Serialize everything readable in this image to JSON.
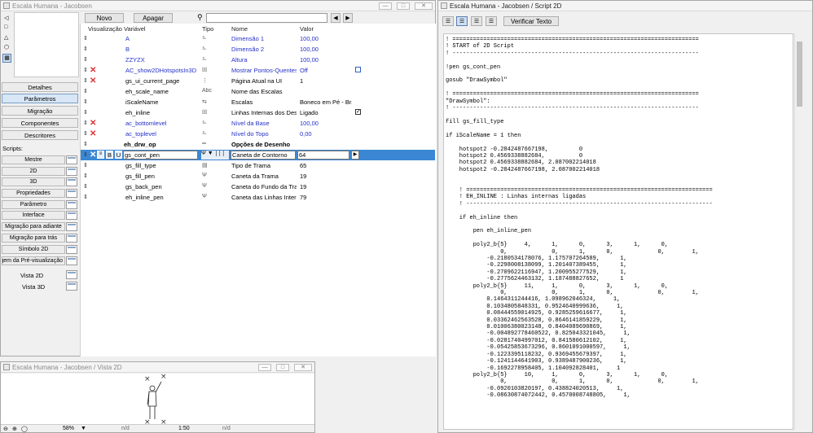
{
  "param_window": {
    "title": "Escala Humana - Jacobsen",
    "new_button": "Novo",
    "delete_button": "Apagar",
    "search_value": "",
    "nav": [
      "Detalhes",
      "Parâmetros",
      "Migração",
      "Componentes",
      "Descritores"
    ],
    "scripts_label": "Scripts:",
    "scripts": [
      "Mestre",
      "2D",
      "3D",
      "Propriedades",
      "Parâmetro",
      "Interface",
      "Migração para adiante",
      "Migração para trás",
      "Símbolo 2D",
      "Imagem da Pré-visualização",
      "Vista 2D",
      "Vista 3D"
    ],
    "columns": [
      "Visualização",
      "Variável",
      "Tipo",
      "Nome",
      "Valor"
    ],
    "rows": [
      {
        "var": "A",
        "name": "Dimensão 1",
        "value": "100,00",
        "style": "blue",
        "x": false,
        "check": ""
      },
      {
        "var": "B",
        "name": "Dimensão 2",
        "value": "100,00",
        "style": "blue",
        "x": false,
        "check": ""
      },
      {
        "var": "ZZYZX",
        "name": "Altura",
        "value": "100,00",
        "style": "blue",
        "x": false,
        "check": ""
      },
      {
        "var": "AC_show2DHotspotsIn3D",
        "name": "Mostrar Pontos-Quentes...",
        "value": "Off",
        "style": "blue",
        "x": true,
        "check": "box"
      },
      {
        "var": "gs_ui_current_page",
        "name": "Página Atual na UI",
        "value": "1",
        "style": "",
        "x": true,
        "check": ""
      },
      {
        "var": "eh_scale_name",
        "name": "Nome das Escalas",
        "value": "",
        "style": "",
        "x": false,
        "check": ""
      },
      {
        "var": "iScaleName",
        "name": "Escalas",
        "value": "Boneco em Pé - Bra...",
        "style": "",
        "x": false,
        "check": ""
      },
      {
        "var": "eh_inline",
        "name": "Linhas Internas dos Des...",
        "value": "Ligado",
        "style": "",
        "x": false,
        "check": "checked"
      },
      {
        "var": "ac_bottomlevel",
        "name": "Nível da Base",
        "value": "100,00",
        "style": "blue",
        "x": true,
        "check": ""
      },
      {
        "var": "ac_toplevel",
        "name": "Nível do Topo",
        "value": "0,00",
        "style": "blue",
        "x": true,
        "check": ""
      },
      {
        "var": "eh_drw_op",
        "name": "Opções de Desenho",
        "value": "",
        "style": "bold",
        "x": false,
        "check": ""
      },
      {
        "var": "gs_cont_pen",
        "name": "Caneta de Contorno",
        "value": "64",
        "style": "sel",
        "x": true,
        "check": ""
      },
      {
        "var": "gs_fill_type",
        "name": "Tipo de Trama",
        "value": "65",
        "style": "",
        "x": false,
        "check": ""
      },
      {
        "var": "gs_fill_pen",
        "name": "Caneta da Trama",
        "value": "19",
        "style": "",
        "x": false,
        "check": ""
      },
      {
        "var": "gs_back_pen",
        "name": "Caneta do Fundo da Tra...",
        "value": "19",
        "style": "",
        "x": false,
        "check": ""
      },
      {
        "var": "eh_inline_pen",
        "name": "Caneta das Linhas Intern...",
        "value": "79",
        "style": "",
        "x": false,
        "check": ""
      }
    ],
    "sel_buttons": [
      "B",
      "U"
    ]
  },
  "script_window": {
    "title": "Escala Humana - Jacobsen / Script 2D",
    "check_button": "Verificar Texto",
    "code": "! ========================================================================\n! START of 2D Script\n! ------------------------------------------------------------------------\n\n!pen gs_cont_pen\n\ngosub \"DrawSymbol\"\n\n! ========================================================================\n\"DrawSymbol\":\n! ------------------------------------------------------------------------\n\nfill gs_fill_type\n\nif iScaleName = 1 then\n\n    hotspot2 -0.2842487667198,         0\n    hotspot2 0.4569338882684,          0\n    hotspot2 0.4569338882684, 2.087002214018\n    hotspot2 -0.2842487667198, 2.087002214018\n\n\n    ! ========================================================================\n    ! EH_INLINE : Linhas internas ligadas\n    ! ------------------------------------------------------------------------\n\n    if eh_inline then\n\n        pen eh_inline_pen\n\n        poly2_b{5}     4,      1,      0,      3,      1,      0,\n                0,             0,      1,      0,             0,        1,\n            -0.2180534178076, 1.175707264589,      1,\n            -0.2298008138099, 1.201407389455,      1,\n            -0.2709622116947, 1.200955277529,      1,\n            -0.2775624463132, 1.187488827652,      1\n        poly2_b{5}     11,     1,      0,      3,      1,      0,\n                0,             0,      1,      0,             0,        1,\n            0.1464311244416, 1.098962046324,     1,\n            0.1034805848331, 0.9524640999636,     1,\n            0.08444559014925, 0.9285259616677,     1,\n            0.03362462563528, 0.8646141859229,     1,\n            0.01006380023148, 0.8404089690869,     1,\n            -0.004892778460522, 0.825043321045,     1,\n            -0.02817404997012, 0.841580612102,     1,\n            -0.05425853673296, 0.8601091000597,     1,\n            -0.1223395118232, 0.9369455679397,     1,\n            -0.1241144641903, 0.9389487900236,     1,\n            -0.1692278958405, 1.104092828401,     1\n        poly2_b{5}     10,     1,      0,      3,      1,      0,\n                0,             0,      1,      0,             0,        1,\n            -0.0920103820197, 0.438824020513,     1,\n            -0.08630874072442, 0.4570008748805,     1,"
  },
  "vista_window": {
    "title": "Escala Humana - Jacobsen / Vista 2D",
    "zoom": "58%",
    "nd1": "n/d",
    "scale": "1:50",
    "nd2": "n/d"
  }
}
